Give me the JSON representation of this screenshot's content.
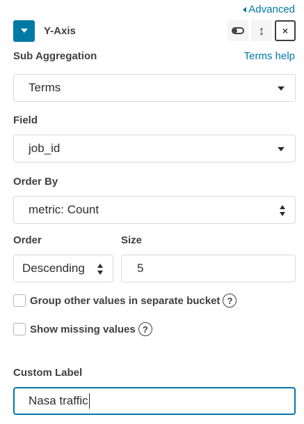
{
  "header": {
    "advanced_label": "Advanced",
    "title": "Y-Axis",
    "close_glyph": "×"
  },
  "sub_aggregation": {
    "label": "Sub Aggregation",
    "help_link": "Terms help",
    "selected": "Terms"
  },
  "field": {
    "label": "Field",
    "selected": "job_id"
  },
  "order_by": {
    "label": "Order By",
    "selected": "metric: Count"
  },
  "order": {
    "label": "Order",
    "selected": "Descending"
  },
  "size": {
    "label": "Size",
    "value": "5"
  },
  "options": {
    "group_other_label": "Group other values in separate bucket",
    "show_missing_label": "Show missing values",
    "help_glyph": "?"
  },
  "custom_label": {
    "label": "Custom Label",
    "value": "Nasa traffic"
  },
  "colors": {
    "accent": "#0079a5",
    "text": "#3f3f3f",
    "border": "#d9d9d9"
  }
}
